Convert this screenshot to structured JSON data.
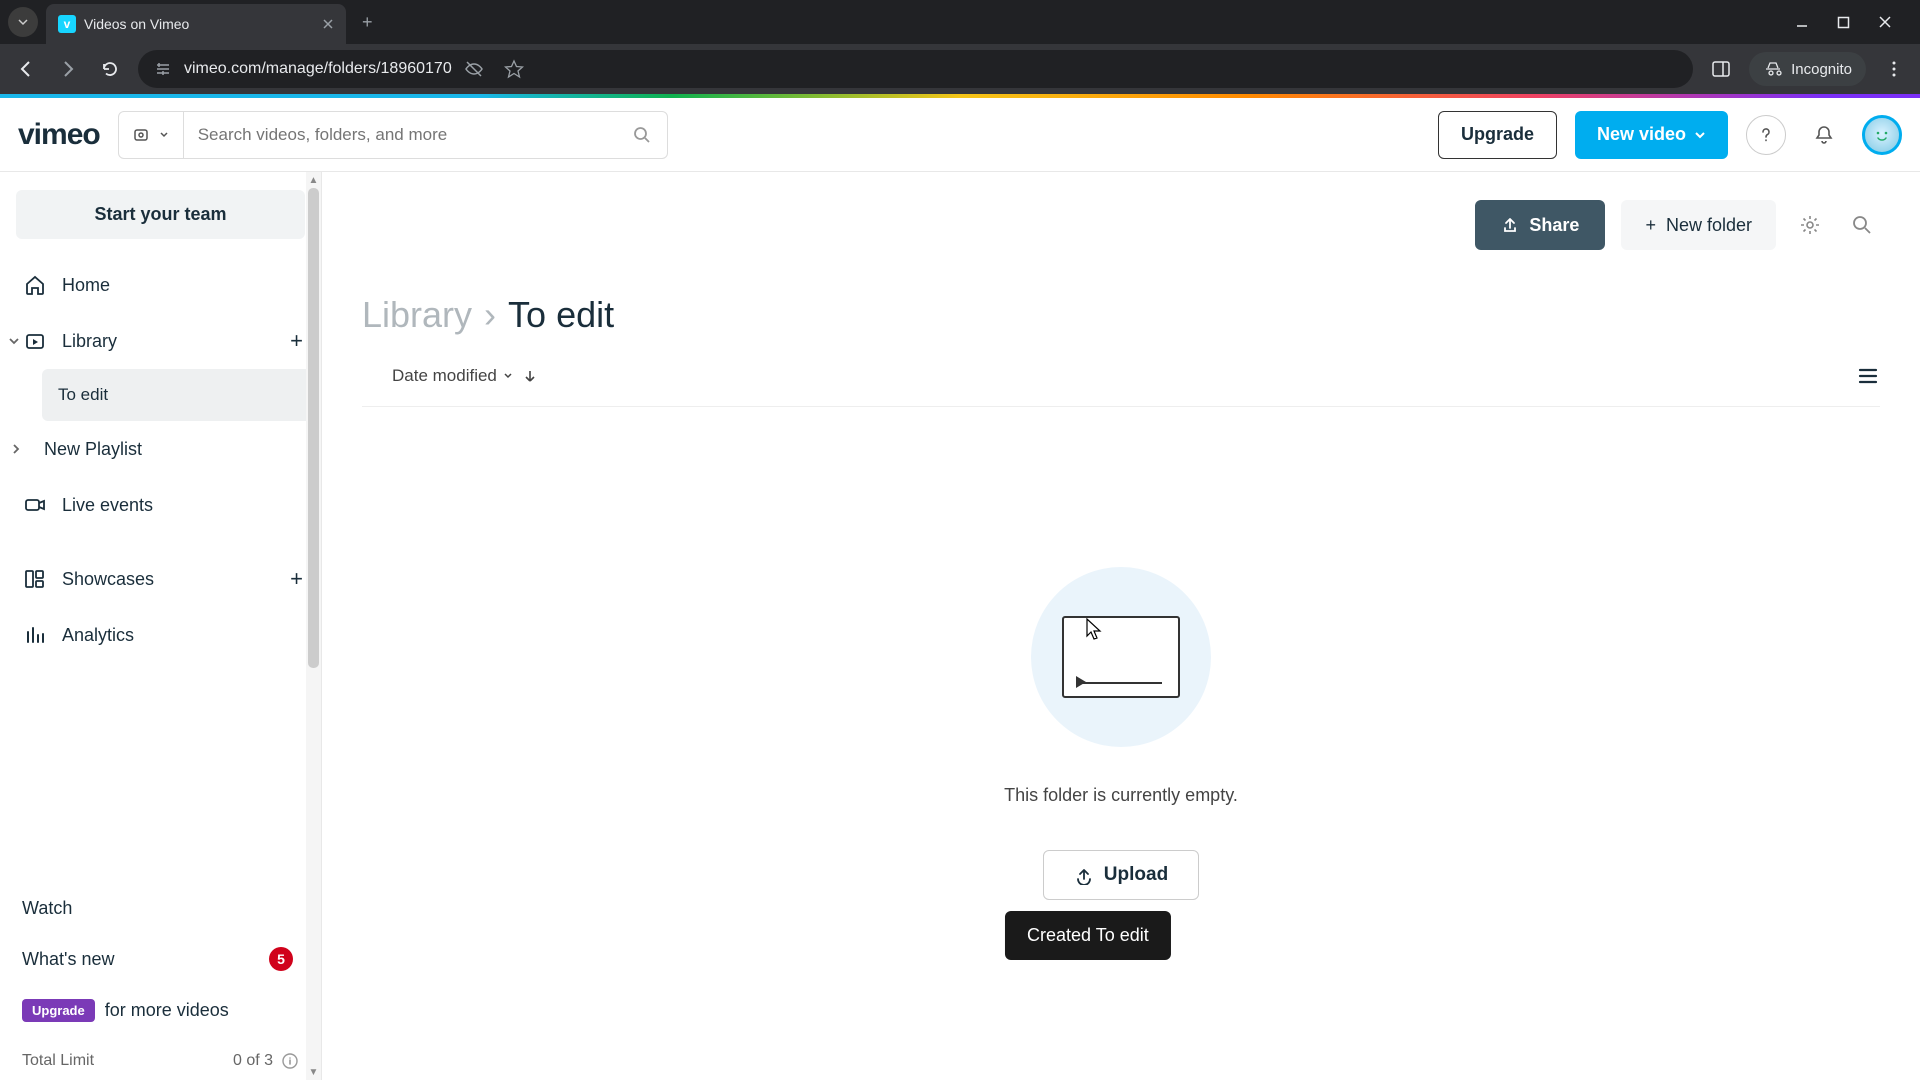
{
  "browser": {
    "tab_title": "Videos on Vimeo",
    "url": "vimeo.com/manage/folders/18960170",
    "incognito_label": "Incognito"
  },
  "header": {
    "logo": "vimeo",
    "search_placeholder": "Search videos, folders, and more",
    "upgrade": "Upgrade",
    "new_video": "New video"
  },
  "sidebar": {
    "team_button": "Start your team",
    "items": {
      "home": "Home",
      "library": "Library",
      "library_child": "To edit",
      "new_playlist": "New Playlist",
      "live_events": "Live events",
      "showcases": "Showcases",
      "analytics": "Analytics"
    },
    "bottom": {
      "watch": "Watch",
      "whats_new": "What's new",
      "whats_new_count": "5",
      "upgrade_pill": "Upgrade",
      "upgrade_text": "for more videos",
      "limit_label": "Total Limit",
      "limit_value": "0 of 3"
    }
  },
  "actions": {
    "share": "Share",
    "new_folder": "New folder"
  },
  "breadcrumb": {
    "root": "Library",
    "sep": "›",
    "current": "To edit"
  },
  "sort": {
    "label": "Date modified"
  },
  "empty": {
    "text": "This folder is currently empty.",
    "upload": "Upload"
  },
  "toast": "Created To edit"
}
